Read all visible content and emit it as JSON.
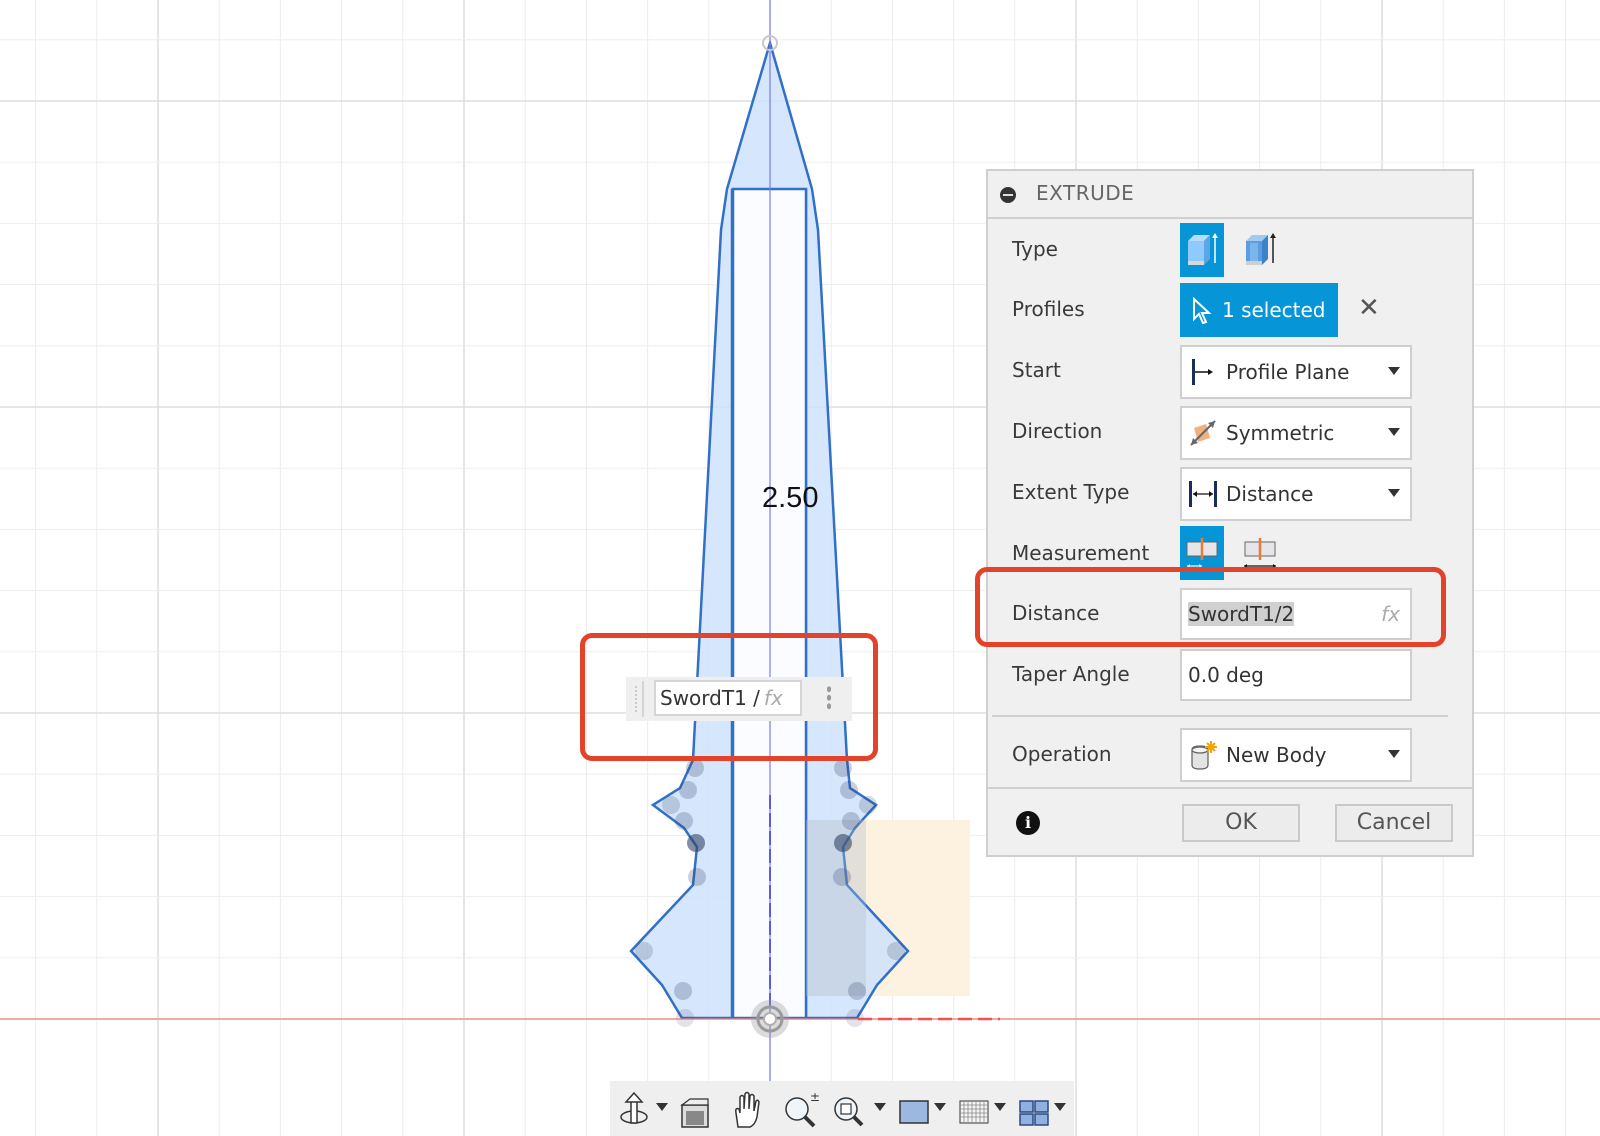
{
  "canvas": {
    "dimension_value": "2.50",
    "inline_input": {
      "value": "SwordT1 /",
      "fx_label": "fx"
    },
    "colors": {
      "profile_fill": "#cfe2fb",
      "profile_stroke": "#3070c8",
      "axis_blue": "#7b7bf0",
      "axis_red": "#f06060",
      "highlight_box": "#fdf1dc",
      "annotation_red": "#e4432b"
    }
  },
  "dialog": {
    "title": "EXTRUDE",
    "rows": {
      "type": {
        "label": "Type",
        "options": [
          "solid-extrude-icon",
          "thin-extrude-icon"
        ],
        "selected": 0
      },
      "profiles": {
        "label": "Profiles",
        "value": "1 selected"
      },
      "start": {
        "label": "Start",
        "value": "Profile Plane"
      },
      "direction": {
        "label": "Direction",
        "value": "Symmetric"
      },
      "extent_type": {
        "label": "Extent Type",
        "value": "Distance"
      },
      "measurement": {
        "label": "Measurement",
        "options": [
          "half-length-icon",
          "whole-length-icon"
        ],
        "selected": 0
      },
      "distance": {
        "label": "Distance",
        "value": "SwordT1/2",
        "fx_label": "fx"
      },
      "taper_angle": {
        "label": "Taper Angle",
        "value": "0.0 deg"
      },
      "operation": {
        "label": "Operation",
        "value": "New Body"
      }
    },
    "ok_label": "OK",
    "cancel_label": "Cancel",
    "accent_color": "#0696d7"
  },
  "nav_toolbar": {
    "items": [
      "orbit-icon",
      "look-at-icon",
      "pan-icon",
      "zoom-icon",
      "fit-icon",
      "display-settings-icon",
      "grid-settings-icon",
      "viewports-icon"
    ]
  }
}
